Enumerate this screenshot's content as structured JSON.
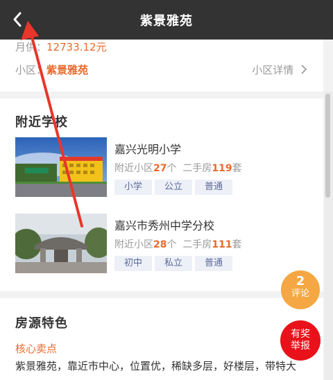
{
  "navbar": {
    "title": "紫景雅苑",
    "back_icon": "chevron-left-icon"
  },
  "summary": {
    "price_label": "月供：",
    "price_value": "12733.12元",
    "community_label": "小区：",
    "community_value": "紫景雅苑",
    "detail_link": "小区详情",
    "detail_icon": "chevron-right-icon"
  },
  "schools": {
    "title": "附近学校",
    "items": [
      {
        "name": "嘉兴光明小学",
        "stat_prefix": "附近小区",
        "nearby_count": "27",
        "stat_mid": "个  二手房",
        "listing_count": "119",
        "stat_suffix": "套",
        "tags": [
          "小学",
          "公立",
          "普通"
        ]
      },
      {
        "name": "嘉兴市秀州中学分校",
        "stat_prefix": "附近小区",
        "nearby_count": "28",
        "stat_mid": "个  二手房",
        "listing_count": "111",
        "stat_suffix": "套",
        "tags": [
          "初中",
          "私立",
          "普通"
        ]
      }
    ]
  },
  "features": {
    "title": "房源特色",
    "subhead": "核心卖点",
    "text": "紫景雅苑，靠近市中心，位置优，稀缺多层，好楼层，带特大"
  },
  "floating": {
    "comment_count": "2",
    "comment_label": "评论",
    "report_label": "有奖举报"
  },
  "colors": {
    "accent": "#e8692b",
    "navbar": "#333333",
    "comment": "#f4a742",
    "report": "#e9121a",
    "annotation_arrow": "#e8362a"
  }
}
